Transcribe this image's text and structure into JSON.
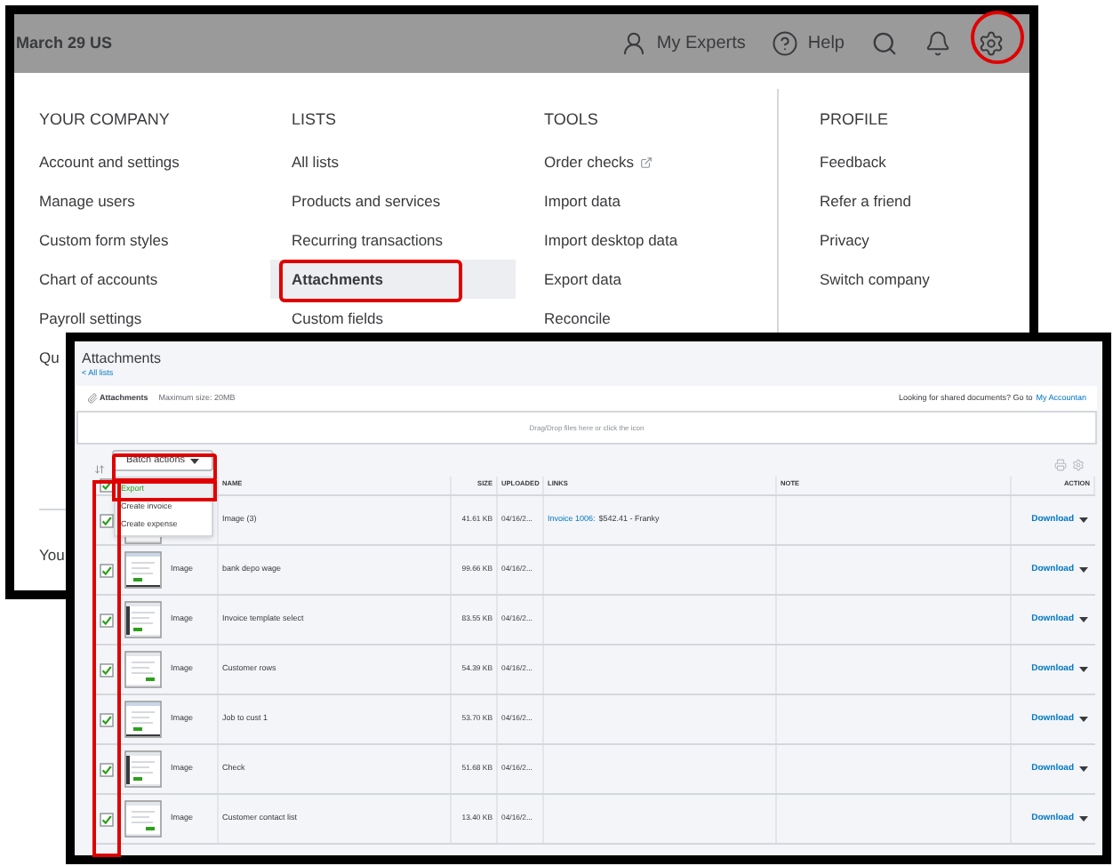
{
  "top_bar": {
    "company": "March 29 US",
    "items": [
      {
        "kind": "experts",
        "label": "My Experts"
      },
      {
        "kind": "help",
        "label": "Help"
      }
    ]
  },
  "menu": {
    "columns": [
      {
        "heading": "YOUR COMPANY",
        "items": [
          {
            "label": "Account and settings",
            "selected": false
          },
          {
            "label": "Manage users",
            "selected": false
          },
          {
            "label": "Custom form styles",
            "selected": false
          },
          {
            "label": "Chart of accounts",
            "selected": false
          },
          {
            "label": "Payroll settings",
            "selected": false
          },
          {
            "label": "Qu",
            "selected": false
          }
        ],
        "footer": "You"
      },
      {
        "heading": "LISTS",
        "items": [
          {
            "label": "All lists",
            "selected": false
          },
          {
            "label": "Products and services",
            "selected": false
          },
          {
            "label": "Recurring transactions",
            "selected": false
          },
          {
            "label": "Attachments",
            "selected": true
          },
          {
            "label": "Custom fields",
            "selected": false
          }
        ]
      },
      {
        "heading": "TOOLS",
        "items": [
          {
            "label": "Order checks",
            "selected": false,
            "external": true
          },
          {
            "label": "Import data",
            "selected": false
          },
          {
            "label": "Import desktop data",
            "selected": false
          },
          {
            "label": "Export data",
            "selected": false
          },
          {
            "label": "Reconcile",
            "selected": false
          }
        ]
      },
      {
        "heading": "PROFILE",
        "items": [
          {
            "label": "Feedback",
            "selected": false
          },
          {
            "label": "Refer a friend",
            "selected": false
          },
          {
            "label": "Privacy",
            "selected": false
          },
          {
            "label": "Switch company",
            "selected": false
          }
        ]
      }
    ]
  },
  "attachments": {
    "title": "Attachments",
    "back_link": "< All lists",
    "upload_label": "Attachments",
    "max_size": "Maximum size: 20MB",
    "shared_prompt": "Looking for shared documents? Go to",
    "shared_link": "My Accountan",
    "dropzone": "Drag/Drop files here or click the icon",
    "batch_button": "Batch actions",
    "batch_menu": [
      {
        "label": "Export",
        "selected": true
      },
      {
        "label": "Create invoice",
        "selected": false
      },
      {
        "label": "Create expense",
        "selected": false
      }
    ],
    "all_checked": true,
    "columns": [
      "NAME",
      "SIZE",
      "UPLOADED",
      "LINKS",
      "NOTE",
      "ACTION"
    ],
    "rows": [
      {
        "checked": true,
        "name": "Image (3)",
        "size": "41.61 KB",
        "uploaded": "04/16/2...",
        "link": "Invoice 1006:",
        "link_detail": "$542.41 - Franky",
        "action": "Download"
      },
      {
        "checked": true,
        "type": "Image",
        "name": "bank depo wage",
        "size": "99.66 KB",
        "uploaded": "04/16/2...",
        "action": "Download"
      },
      {
        "checked": true,
        "type": "Image",
        "name": "Invoice template select",
        "size": "83.55 KB",
        "uploaded": "04/16/2...",
        "action": "Download"
      },
      {
        "checked": true,
        "type": "Image",
        "name": "Customer rows",
        "size": "54.39 KB",
        "uploaded": "04/16/2...",
        "action": "Download"
      },
      {
        "checked": true,
        "type": "Image",
        "name": "Job to cust 1",
        "size": "53.70 KB",
        "uploaded": "04/16/2...",
        "action": "Download"
      },
      {
        "checked": true,
        "type": "Image",
        "name": "Check",
        "size": "51.68 KB",
        "uploaded": "04/16/2...",
        "action": "Download"
      },
      {
        "checked": true,
        "type": "Image",
        "name": "Customer contact list",
        "size": "13.40 KB",
        "uploaded": "04/16/2...",
        "action": "Download"
      }
    ]
  }
}
